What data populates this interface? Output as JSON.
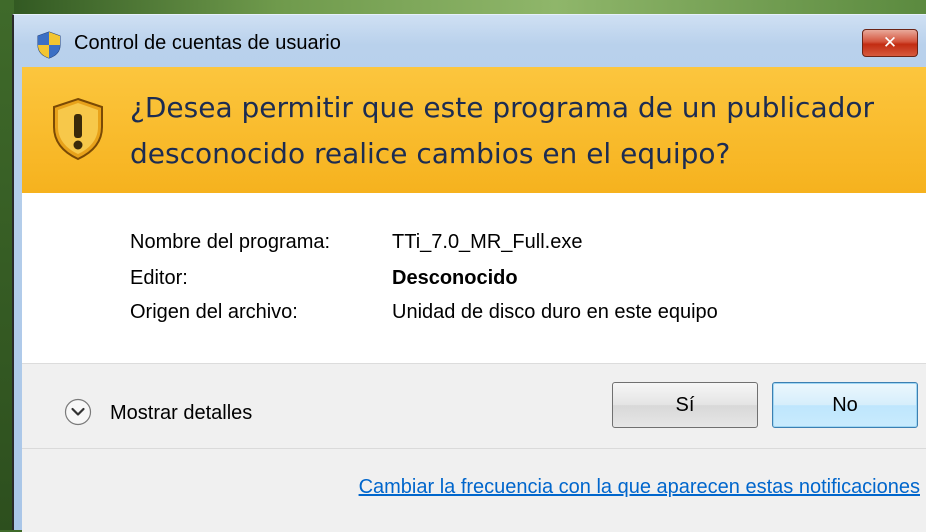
{
  "window": {
    "title": "Control de cuentas de usuario",
    "close_label": "✕"
  },
  "banner": {
    "line1": "¿Desea permitir que este programa de un publicador",
    "line2": "desconocido realice cambios en el equipo?"
  },
  "info": {
    "program_label": "Nombre del programa:",
    "program_value": "TTi_7.0_MR_Full.exe",
    "publisher_label": "Editor:",
    "publisher_value": "Desconocido",
    "origin_label": "Origen del archivo:",
    "origin_value": "Unidad de disco duro en este equipo"
  },
  "footer": {
    "details_label": "Mostrar detalles",
    "yes_label": "Sí",
    "no_label": "No",
    "notifications_link": "Cambiar la frecuencia con la que aparecen estas notificaciones"
  },
  "icons": {
    "title_icon": "uac-shield-icon",
    "banner_icon": "warning-shield-icon",
    "details_icon": "chevron-down-circle-icon"
  },
  "colors": {
    "banner": "#f6b21e",
    "banner_text": "#1c2c52",
    "link": "#0066cc",
    "close_button": "#c22c12"
  }
}
